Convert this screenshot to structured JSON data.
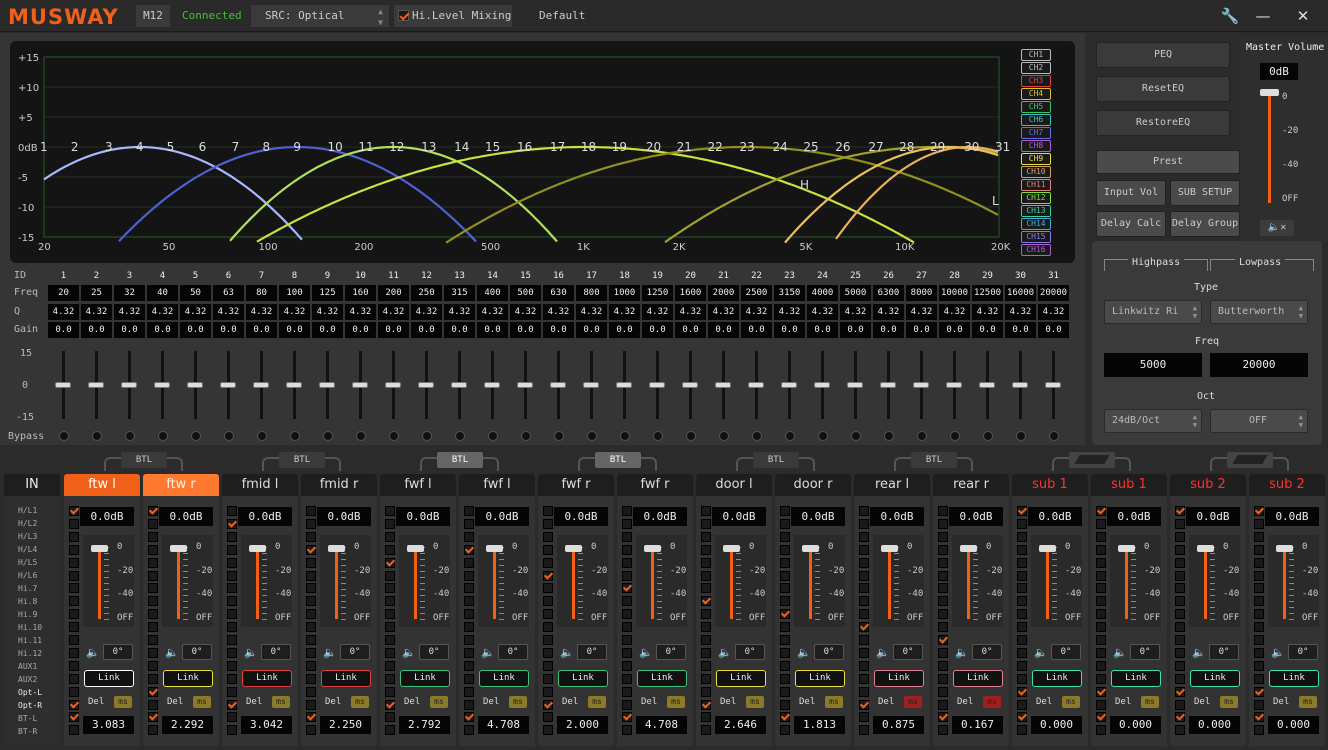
{
  "app": {
    "logo": "MUSWAY",
    "model": "M12",
    "status": "Connected",
    "source": "SRC: Optical",
    "hi_level_label": "Hi.Level Mixing",
    "preset": "Default"
  },
  "eq_graph": {
    "y_ticks": [
      "+15",
      "+10",
      "+5",
      "0dB",
      "-5",
      "-10",
      "-15"
    ],
    "x_ticks": [
      "20",
      "50",
      "100",
      "200",
      "500",
      "1K",
      "2K",
      "5K",
      "10K",
      "20K"
    ],
    "band_numbers": [
      "1",
      "2",
      "3",
      "4",
      "5",
      "6",
      "7",
      "8",
      "9",
      "10",
      "11",
      "12",
      "13",
      "14",
      "15",
      "16",
      "17",
      "18",
      "19",
      "20",
      "21",
      "22",
      "23",
      "24",
      "25",
      "26",
      "27",
      "28",
      "29",
      "30",
      "31"
    ],
    "marker_h": "H",
    "marker_l": "L"
  },
  "channel_legend": [
    "CH1",
    "CH2",
    "CH3",
    "CH4",
    "CH5",
    "CH6",
    "CH7",
    "CH8",
    "CH9",
    "CH10",
    "CH11",
    "CH12",
    "CH13",
    "CH14",
    "CH15",
    "CH16"
  ],
  "legend_colors": [
    "#bbbbbb",
    "#bbbbbb",
    "#e04040",
    "#d8c030",
    "#40c060",
    "#40c0c0",
    "#6070e0",
    "#b060d0",
    "#e8e040",
    "#d8a060",
    "#e08080",
    "#80e040",
    "#40d0a0",
    "#40b0e0",
    "#8080e0",
    "#b060d0"
  ],
  "eq_table": {
    "labels": {
      "id": "ID",
      "freq": "Freq",
      "q": "Q",
      "gain": "Gain",
      "bypass": "Bypass"
    },
    "ids": [
      "1",
      "2",
      "3",
      "4",
      "5",
      "6",
      "7",
      "8",
      "9",
      "10",
      "11",
      "12",
      "13",
      "14",
      "15",
      "16",
      "17",
      "18",
      "19",
      "20",
      "21",
      "22",
      "23",
      "24",
      "25",
      "26",
      "27",
      "28",
      "29",
      "30",
      "31"
    ],
    "freq": [
      "20",
      "25",
      "32",
      "40",
      "50",
      "63",
      "80",
      "100",
      "125",
      "160",
      "200",
      "250",
      "315",
      "400",
      "500",
      "630",
      "800",
      "1000",
      "1250",
      "1600",
      "2000",
      "2500",
      "3150",
      "4000",
      "5000",
      "6300",
      "8000",
      "10000",
      "12500",
      "16000",
      "20000"
    ],
    "q": [
      "4.32",
      "4.32",
      "4.32",
      "4.32",
      "4.32",
      "4.32",
      "4.32",
      "4.32",
      "4.32",
      "4.32",
      "4.32",
      "4.32",
      "4.32",
      "4.32",
      "4.32",
      "4.32",
      "4.32",
      "4.32",
      "4.32",
      "4.32",
      "4.32",
      "4.32",
      "4.32",
      "4.32",
      "4.32",
      "4.32",
      "4.32",
      "4.32",
      "4.32",
      "4.32",
      "4.32"
    ],
    "gain": [
      "0.0",
      "0.0",
      "0.0",
      "0.0",
      "0.0",
      "0.0",
      "0.0",
      "0.0",
      "0.0",
      "0.0",
      "0.0",
      "0.0",
      "0.0",
      "0.0",
      "0.0",
      "0.0",
      "0.0",
      "0.0",
      "0.0",
      "0.0",
      "0.0",
      "0.0",
      "0.0",
      "0.0",
      "0.0",
      "0.0",
      "0.0",
      "0.0",
      "0.0",
      "0.0",
      "0.0"
    ],
    "slider_scale": {
      "top": "15",
      "mid": "0",
      "bottom": "-15"
    }
  },
  "buttons": {
    "peq": "PEQ",
    "reset": "ResetEQ",
    "restore": "RestoreEQ",
    "prest": "Prest",
    "input_vol": "Input Vol",
    "sub_setup": "SUB SETUP",
    "delay_calc": "Delay Calc",
    "delay_group": "Delay Group"
  },
  "master": {
    "title": "Master Volume",
    "value": "0dB",
    "scale": [
      "0",
      "-20",
      "-40",
      "OFF"
    ]
  },
  "filter": {
    "highpass": "Highpass",
    "lowpass": "Lowpass",
    "type_label": "Type",
    "hp_type": "Linkwitz Ri",
    "lp_type": "Butterworth",
    "freq_label": "Freq",
    "hp_freq": "5000",
    "lp_freq": "20000",
    "oct_label": "Oct",
    "hp_oct": "24dB/Oct",
    "lp_oct": "OFF"
  },
  "inputs": {
    "title": "IN",
    "items": [
      "H/L1",
      "H/L2",
      "H/L3",
      "H/L4",
      "H/L5",
      "H/L6",
      "Hi.7",
      "Hi.8",
      "Hi.9",
      "Hi.10",
      "Hi.11",
      "Hi.12",
      "AUX1",
      "AUX2",
      "Opt-L",
      "Opt-R",
      "BT-L",
      "BT-R"
    ]
  },
  "btl_label": "BTL",
  "channel_strip": {
    "gain": "0.0dB",
    "scale": [
      "0",
      "-20",
      "-40",
      "OFF"
    ],
    "phase": "0°",
    "link": "Link",
    "del": "Del",
    "ms": "ms"
  },
  "channels": [
    {
      "name": "ftw l",
      "delay": "3.083",
      "color": "#ffffff",
      "style": "act"
    },
    {
      "name": "ftw r",
      "delay": "2.292",
      "color": "#e8e040",
      "style": "dim"
    },
    {
      "name": "fmid l",
      "delay": "3.042",
      "color": "#e04040",
      "style": ""
    },
    {
      "name": "fmid r",
      "delay": "2.250",
      "color": "#e04040",
      "style": ""
    },
    {
      "name": "fwf l",
      "delay": "2.792",
      "color": "#40c080",
      "style": ""
    },
    {
      "name": "fwf l",
      "delay": "4.708",
      "color": "#40c080",
      "style": ""
    },
    {
      "name": "fwf r",
      "delay": "2.000",
      "color": "#40c080",
      "style": ""
    },
    {
      "name": "fwf r",
      "delay": "4.708",
      "color": "#40c080",
      "style": ""
    },
    {
      "name": "door l",
      "delay": "2.646",
      "color": "#e8e040",
      "style": ""
    },
    {
      "name": "door r",
      "delay": "1.813",
      "color": "#e8e040",
      "style": ""
    },
    {
      "name": "rear l",
      "delay": "0.875",
      "color": "#e08090",
      "style": ""
    },
    {
      "name": "rear r",
      "delay": "0.167",
      "color": "#e08090",
      "style": ""
    },
    {
      "name": "sub 1",
      "delay": "0.000",
      "color": "#40e0b0",
      "style": "red"
    },
    {
      "name": "sub 1",
      "delay": "0.000",
      "color": "#40e0b0",
      "style": "red"
    },
    {
      "name": "sub 2",
      "delay": "0.000",
      "color": "#40e0b0",
      "style": "red"
    },
    {
      "name": "sub 2",
      "delay": "0.000",
      "color": "#40e0b0",
      "style": "red"
    }
  ]
}
